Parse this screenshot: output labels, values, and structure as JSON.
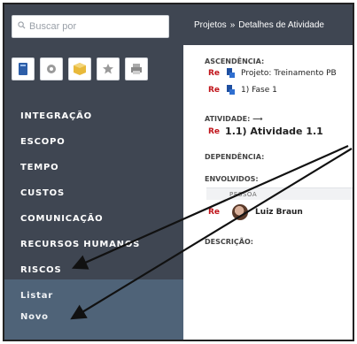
{
  "search": {
    "placeholder": "Buscar por",
    "icon": "search-icon"
  },
  "toolbar": {
    "icons": [
      "book-icon",
      "gear-icon",
      "box-icon",
      "star-icon",
      "print-icon"
    ]
  },
  "sidebar": {
    "items": [
      {
        "label": "INTEGRAÇÃO"
      },
      {
        "label": "ESCOPO"
      },
      {
        "label": "TEMPO"
      },
      {
        "label": "CUSTOS"
      },
      {
        "label": "COMUNICAÇÃO"
      },
      {
        "label": "RECURSOS HUMANOS"
      },
      {
        "label": "RISCOS"
      }
    ],
    "submenu": [
      {
        "label": "Listar"
      },
      {
        "label": "Novo"
      }
    ]
  },
  "header": {
    "breadcrumb": [
      "Projetos",
      "»",
      "Detalhes de Atividade"
    ]
  },
  "detail": {
    "ascendencia_label": "ASCENDÊNCIA:",
    "ascendencia": [
      {
        "tag": "Re",
        "text": "Projeto: Treinamento PB"
      },
      {
        "tag": "Re",
        "text": "1) Fase 1"
      }
    ],
    "atividade_label": "ATIVIDADE: ⟶",
    "atividade": {
      "tag": "Re",
      "text": "1.1) Atividade 1.1"
    },
    "dependencia_label": "DEPENDÊNCIA:",
    "envolvidos_label": "ENVOLVIDOS:",
    "envolvidos_header": "PESSOA",
    "envolvidos": [
      {
        "tag": "Re",
        "name": "Luiz Braun"
      }
    ],
    "descricao_label": "DESCRIÇÃO:"
  },
  "colors": {
    "sidebar": "#3f4652",
    "submenu": "#4f6378",
    "tag_red": "#c0141a",
    "project_blue": "#1f4fa0"
  }
}
